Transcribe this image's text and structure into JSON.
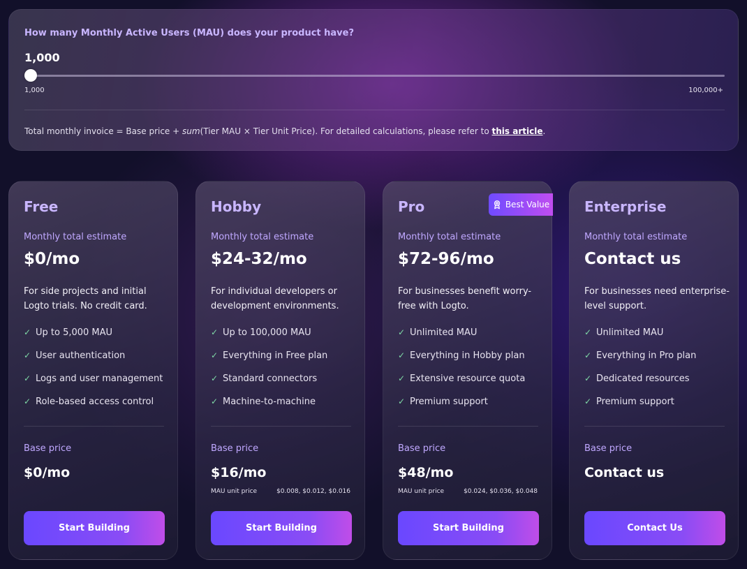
{
  "calculator": {
    "question": "How many Monthly Active Users (MAU) does your product have?",
    "mau_value": "1,000",
    "slider_level": 0,
    "min_label": "1,000",
    "max_label": "100,000+",
    "formula_prefix": "Total monthly invoice = Base price + ",
    "formula_sum": "sum",
    "formula_suffix": "(Tier MAU × Tier Unit Price). For detailed calculations, please refer to ",
    "formula_link": "this article",
    "formula_end": "."
  },
  "badge": {
    "label": "Best Value",
    "icon": "award-icon"
  },
  "colors": {
    "accent": "#c9b6ff",
    "button_start": "#6a48ff",
    "button_end": "#c04de8",
    "check": "#7fd9a6"
  },
  "plans": [
    {
      "name": "Free",
      "estimate_label": "Monthly total estimate",
      "estimate": "$0/mo",
      "description": "For side projects and initial Logto trials. No credit card.",
      "features": [
        "Up to 5,000 MAU",
        "User authentication",
        "Logs and user management",
        "Role-based access control"
      ],
      "base_label": "Base price",
      "base_price": "$0/mo",
      "unit_label": "",
      "unit_prices": "",
      "cta": "Start Building"
    },
    {
      "name": "Hobby",
      "estimate_label": "Monthly total estimate",
      "estimate": "$24-32/mo",
      "description": "For individual developers or development environments.",
      "features": [
        "Up to 100,000 MAU",
        "Everything in Free plan",
        "Standard connectors",
        "Machine-to-machine"
      ],
      "base_label": "Base price",
      "base_price": "$16/mo",
      "unit_label": "MAU unit price",
      "unit_prices": "$0.008, $0.012, $0.016",
      "cta": "Start Building"
    },
    {
      "name": "Pro",
      "estimate_label": "Monthly total estimate",
      "estimate": "$72-96/mo",
      "description": "For businesses benefit worry-free with Logto.",
      "features": [
        "Unlimited MAU",
        "Everything in Hobby plan",
        "Extensive resource quota",
        "Premium support"
      ],
      "base_label": "Base price",
      "base_price": "$48/mo",
      "unit_label": "MAU unit price",
      "unit_prices": "$0.024, $0.036, $0.048",
      "cta": "Start Building"
    },
    {
      "name": "Enterprise",
      "estimate_label": "Monthly total estimate",
      "estimate": "Contact us",
      "description": "For businesses need enterprise-level support.",
      "features": [
        "Unlimited MAU",
        "Everything in Pro plan",
        "Dedicated resources",
        "Premium support"
      ],
      "base_label": "Base price",
      "base_price": "Contact us",
      "unit_label": "",
      "unit_prices": "",
      "cta": "Contact Us"
    }
  ]
}
